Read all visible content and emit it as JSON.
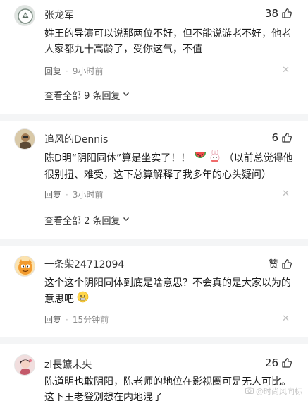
{
  "comments": [
    {
      "username": "张龙军",
      "likes": "38",
      "text": "姓王的导演可以说那两位不好，但不能说游老不好，他老人家都九十高龄了，受你这气，不值",
      "reply_label": "回复",
      "time": "9小时前",
      "view_all": "查看全部 9 条回复"
    },
    {
      "username": "追风的Dennis",
      "likes": "6",
      "text_before_emoji": "陈D明“阴阳同体”算是坐实了！！",
      "text_after_emoji": "（以前总觉得他很别扭、难受，这下总算解释了我多年的心头疑问）",
      "reply_label": "回复",
      "time": "3小时前",
      "view_all": "查看全部 2 条回复"
    },
    {
      "username": "一条柴24712094",
      "likes": "赞",
      "text": "这个这个阴阳同体到底是啥意思？不会真的是大家以为的意思吧",
      "reply_label": "回复",
      "time": "15分钟前"
    },
    {
      "username": "zl長鑣未央",
      "likes": "26",
      "text": "陈道明也敢阴阳，陈老师的地位在影视圈可是无人可比。这下王老登别想在内地混了"
    }
  ],
  "watermark": "@时尚风向标",
  "colors": {
    "divider": "#f4f5f6",
    "meta": "#8a8a8a",
    "text": "#191919"
  }
}
